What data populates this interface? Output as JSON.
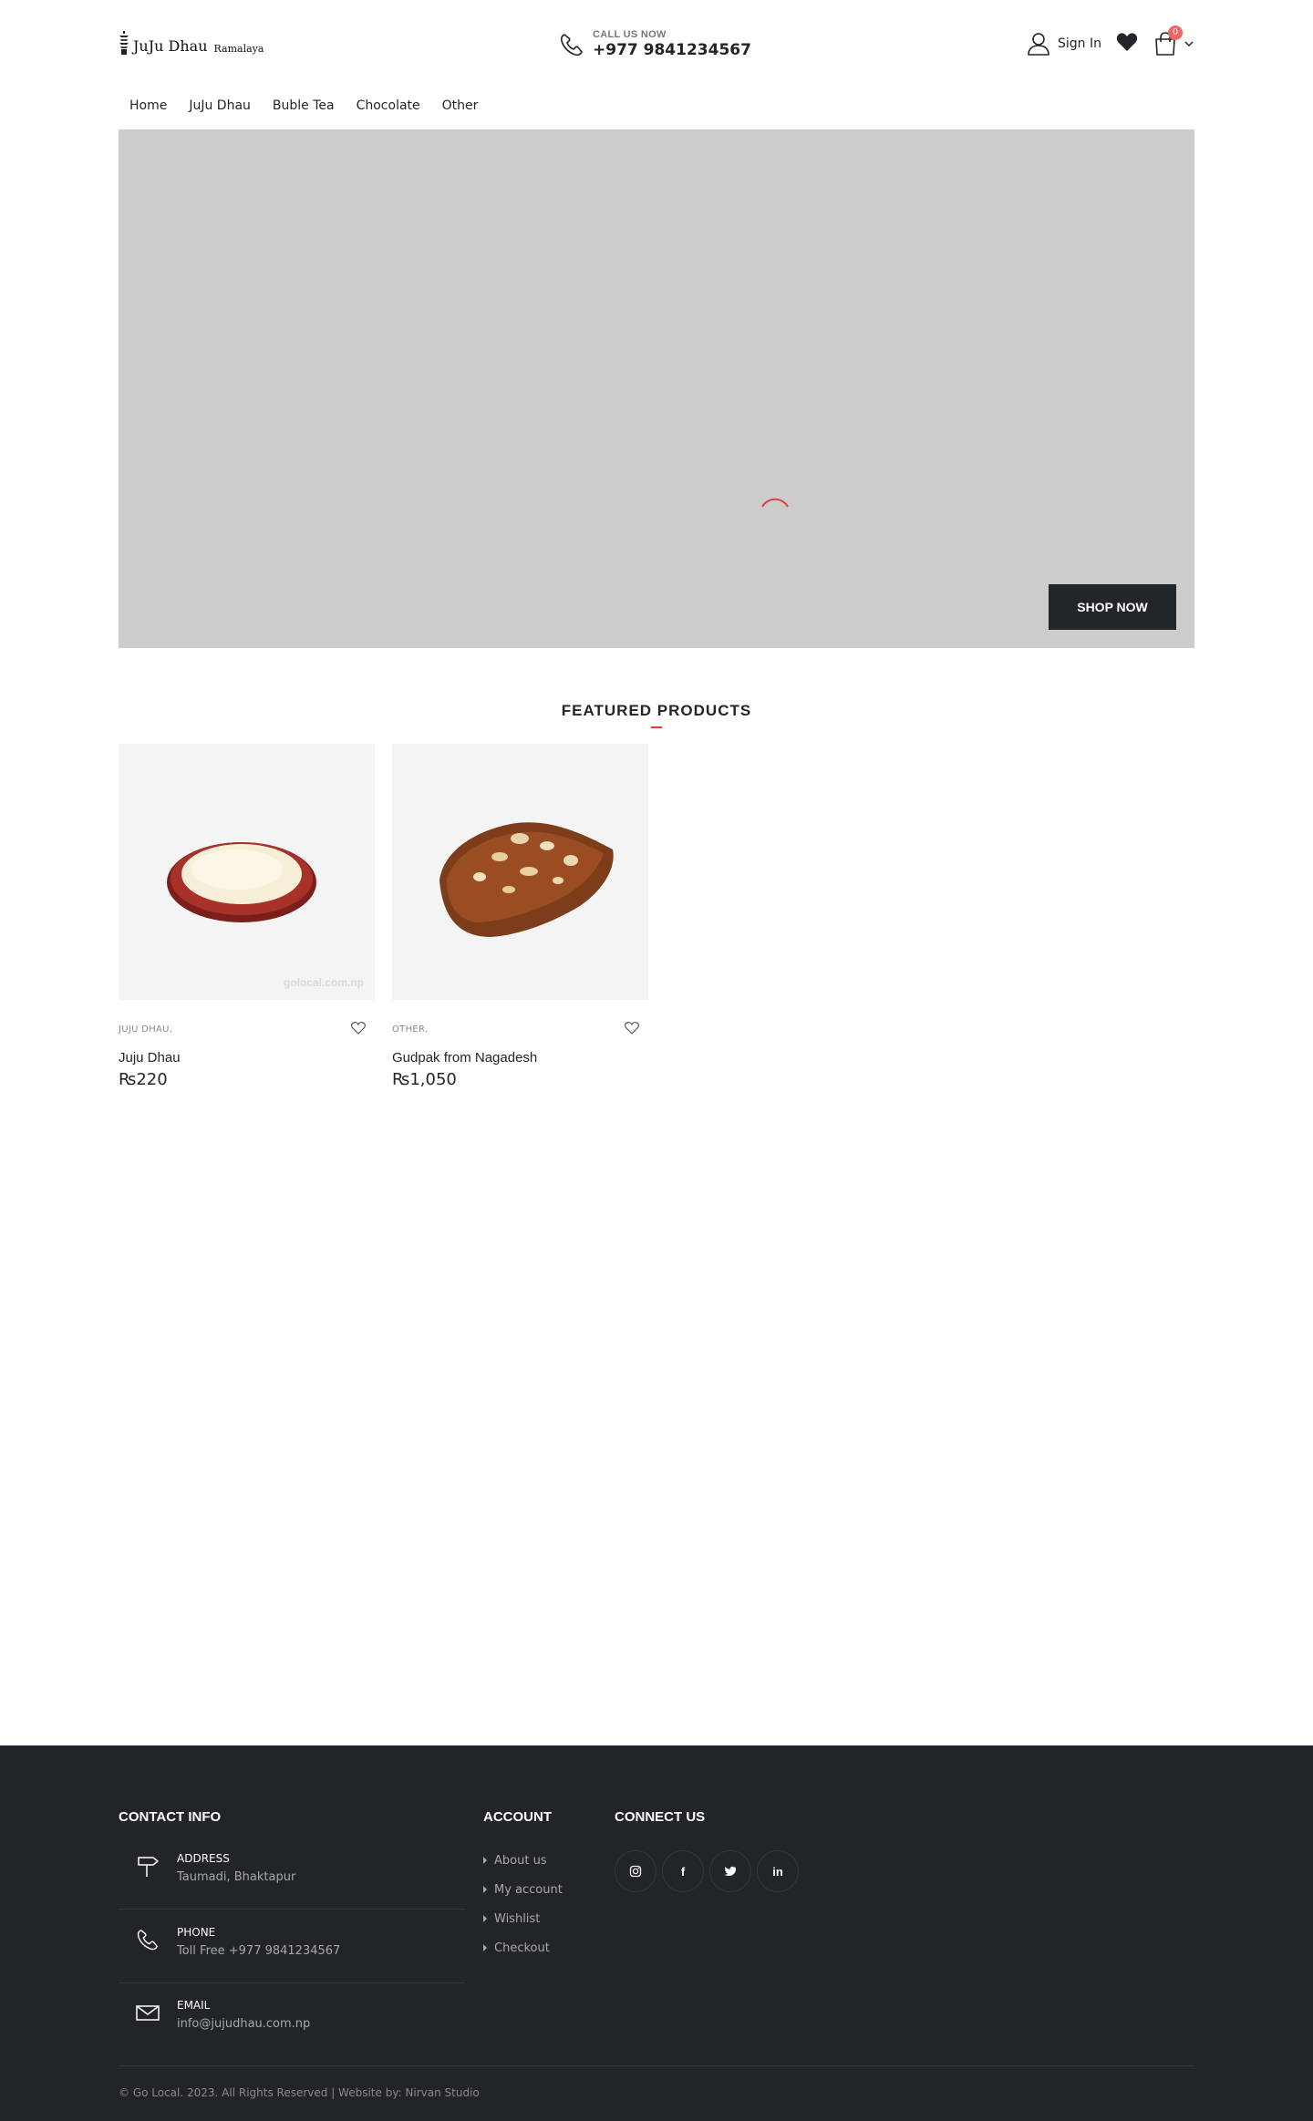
{
  "header": {
    "logo_text": "JuJu Dhau",
    "logo_sub": "Ramalaya",
    "call_label": "CALL US NOW",
    "call_number": "+977 9841234567",
    "signin_label": "Sign In",
    "cart_count": "0"
  },
  "nav": {
    "items": [
      {
        "label": "Home"
      },
      {
        "label": "JuJu Dhau"
      },
      {
        "label": "Buble Tea"
      },
      {
        "label": "Chocolate"
      },
      {
        "label": "Other"
      }
    ]
  },
  "hero": {
    "button_label": "SHOP NOW"
  },
  "featured": {
    "title": "FEATURED PRODUCTS",
    "products": [
      {
        "category": "JUJU DHAU,",
        "name": "Juju Dhau",
        "price": "₨220",
        "watermark": "golocal.com.np"
      },
      {
        "category": "OTHER,",
        "name": "Gudpak from Nagadesh",
        "price": "₨1,050"
      }
    ]
  },
  "footer": {
    "contact_title": "CONTACT INFO",
    "contacts": [
      {
        "label": "ADDRESS",
        "value": "Taumadi, Bhaktapur",
        "icon": "signpost-icon"
      },
      {
        "label": "PHONE",
        "value": "Toll Free +977 9841234567",
        "icon": "phone-icon"
      },
      {
        "label": "EMAIL",
        "value": "info@jujudhau.com.np",
        "icon": "envelope-icon"
      }
    ],
    "account_title": "ACCOUNT",
    "account_links": [
      {
        "label": "About us"
      },
      {
        "label": "My account"
      },
      {
        "label": "Wishlist"
      },
      {
        "label": "Checkout"
      }
    ],
    "connect_title": "CONNECT US",
    "socials": [
      {
        "icon": "instagram-icon"
      },
      {
        "icon": "facebook-icon",
        "glyph": "f"
      },
      {
        "icon": "twitter-icon"
      },
      {
        "icon": "linkedin-icon",
        "glyph": "in"
      }
    ],
    "copyright": "© Go Local. 2023. All Rights Reserved | Website by: Nirvan Studio"
  },
  "colors": {
    "accent": "#e23c3c",
    "dark": "#222529",
    "footer_bg": "#212429",
    "hero_bg": "#cccccc",
    "badge": "#ee6564"
  }
}
